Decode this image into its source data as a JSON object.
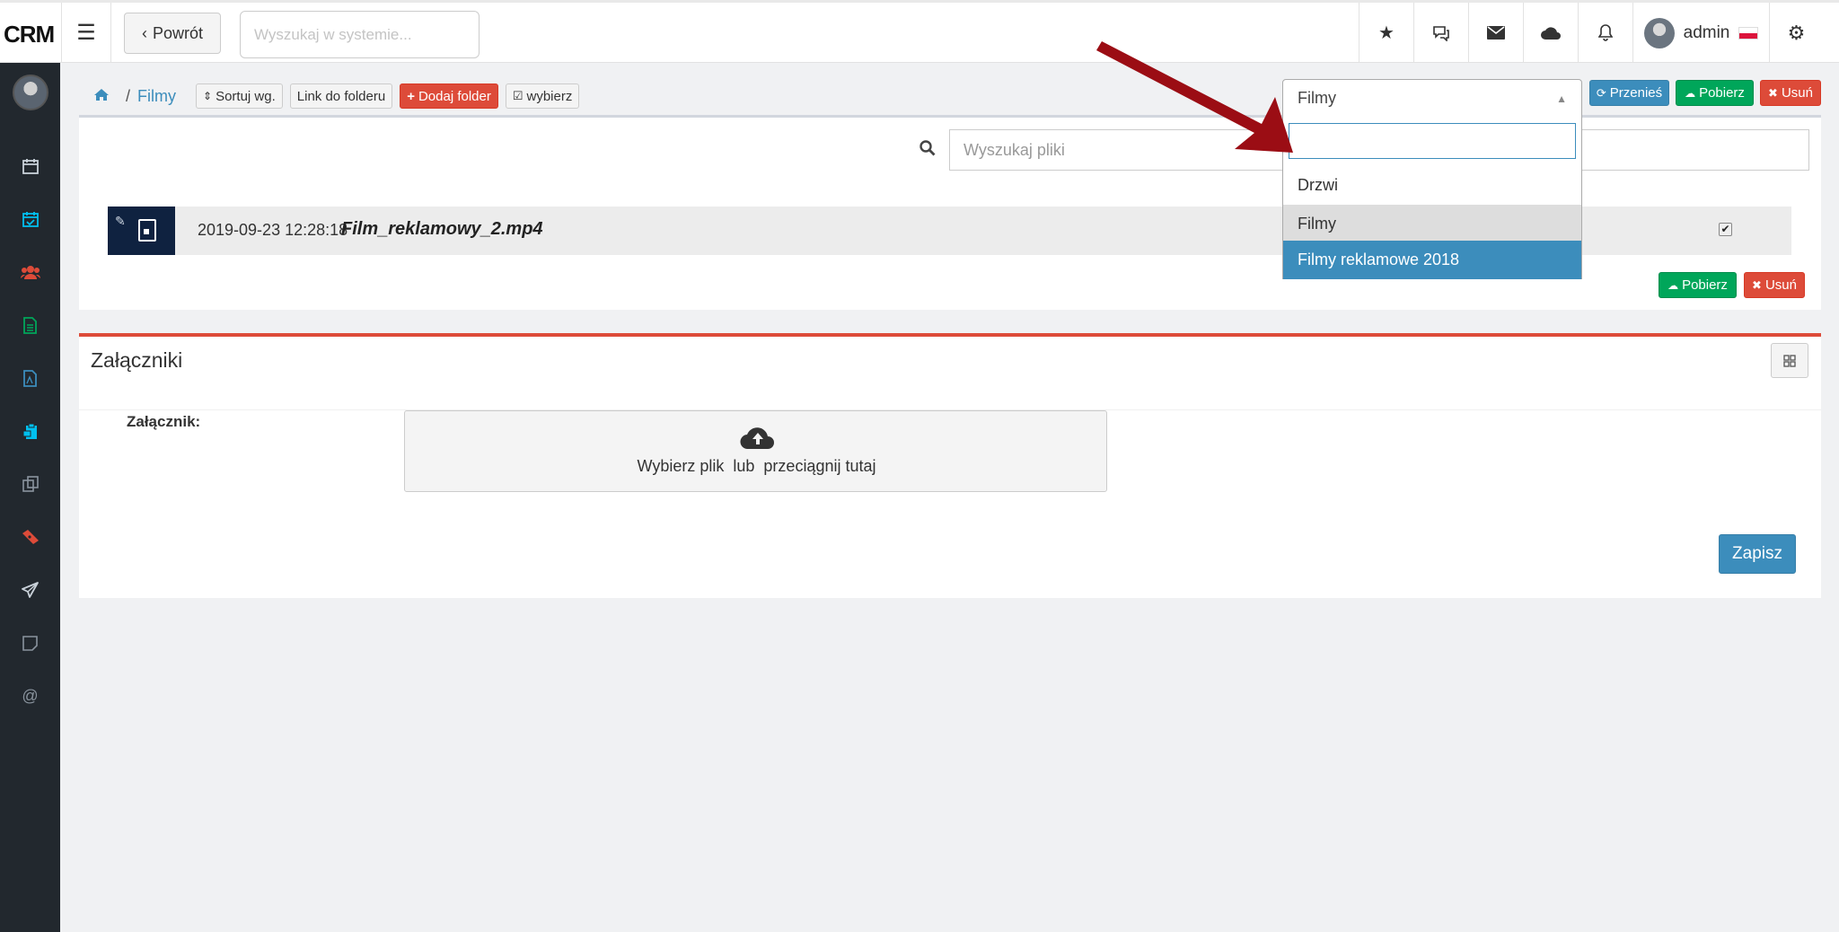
{
  "header": {
    "brand": "CRM",
    "back_label": "Powrót",
    "search_placeholder": "Wyszukaj w systemie...",
    "user_name": "admin",
    "icons": [
      "star-icon",
      "comments-icon",
      "envelope-icon",
      "cloud-icon",
      "bell-icon"
    ]
  },
  "sidebar": {
    "items": [
      {
        "icon": "calendar-icon",
        "color": "#c9d1d9"
      },
      {
        "icon": "calendar-check-icon",
        "color": "#00c0ef"
      },
      {
        "icon": "users-icon",
        "color": "#dd4b39"
      },
      {
        "icon": "document-icon",
        "color": "#00a65a"
      },
      {
        "icon": "pdf-icon",
        "color": "#3c8dbc"
      },
      {
        "icon": "clipboard-icon",
        "color": "#00c0ef"
      },
      {
        "icon": "copy-icon",
        "color": "#8a949e"
      },
      {
        "icon": "ticket-icon",
        "color": "#dd4b39"
      },
      {
        "icon": "send-icon",
        "color": "#c9d1d9"
      },
      {
        "icon": "note-icon",
        "color": "#8a949e"
      },
      {
        "icon": "at-icon",
        "color": "#8a949e"
      }
    ]
  },
  "breadcrumb": {
    "separator": "/",
    "current": "Filmy"
  },
  "toolbar": {
    "sort_label": "Sortuj wg.",
    "link_label": "Link do folderu",
    "add_folder_label": "Dodaj folder",
    "select_label": "wybierz"
  },
  "folder_select": {
    "value": "Filmy",
    "search_value": "",
    "options": [
      "Drzwi",
      "Filmy",
      "Filmy reklamowe 2018"
    ],
    "current_option": "Filmy",
    "highlighted_option": "Filmy reklamowe 2018"
  },
  "actions": {
    "move_label": "Przenieś",
    "download_label": "Pobierz",
    "delete_label": "Usuń"
  },
  "files": {
    "search_placeholder": "Wyszukaj pliki",
    "items": [
      {
        "date": "2019-09-23 12:28:18",
        "name": "Film_reklamowy_2.mp4",
        "checked": true
      }
    ]
  },
  "attachments": {
    "title": "Załączniki",
    "field_label": "Załącznik:",
    "dropzone_choose": "Wybierz plik",
    "dropzone_or": "lub",
    "dropzone_drag": "przeciągnij tutaj",
    "save_label": "Zapisz"
  },
  "colors": {
    "primary": "#3c8dbc",
    "success": "#00a65a",
    "danger": "#dd4b39",
    "sidebar_bg": "#22282e",
    "annotation_arrow": "#9b0d14"
  }
}
